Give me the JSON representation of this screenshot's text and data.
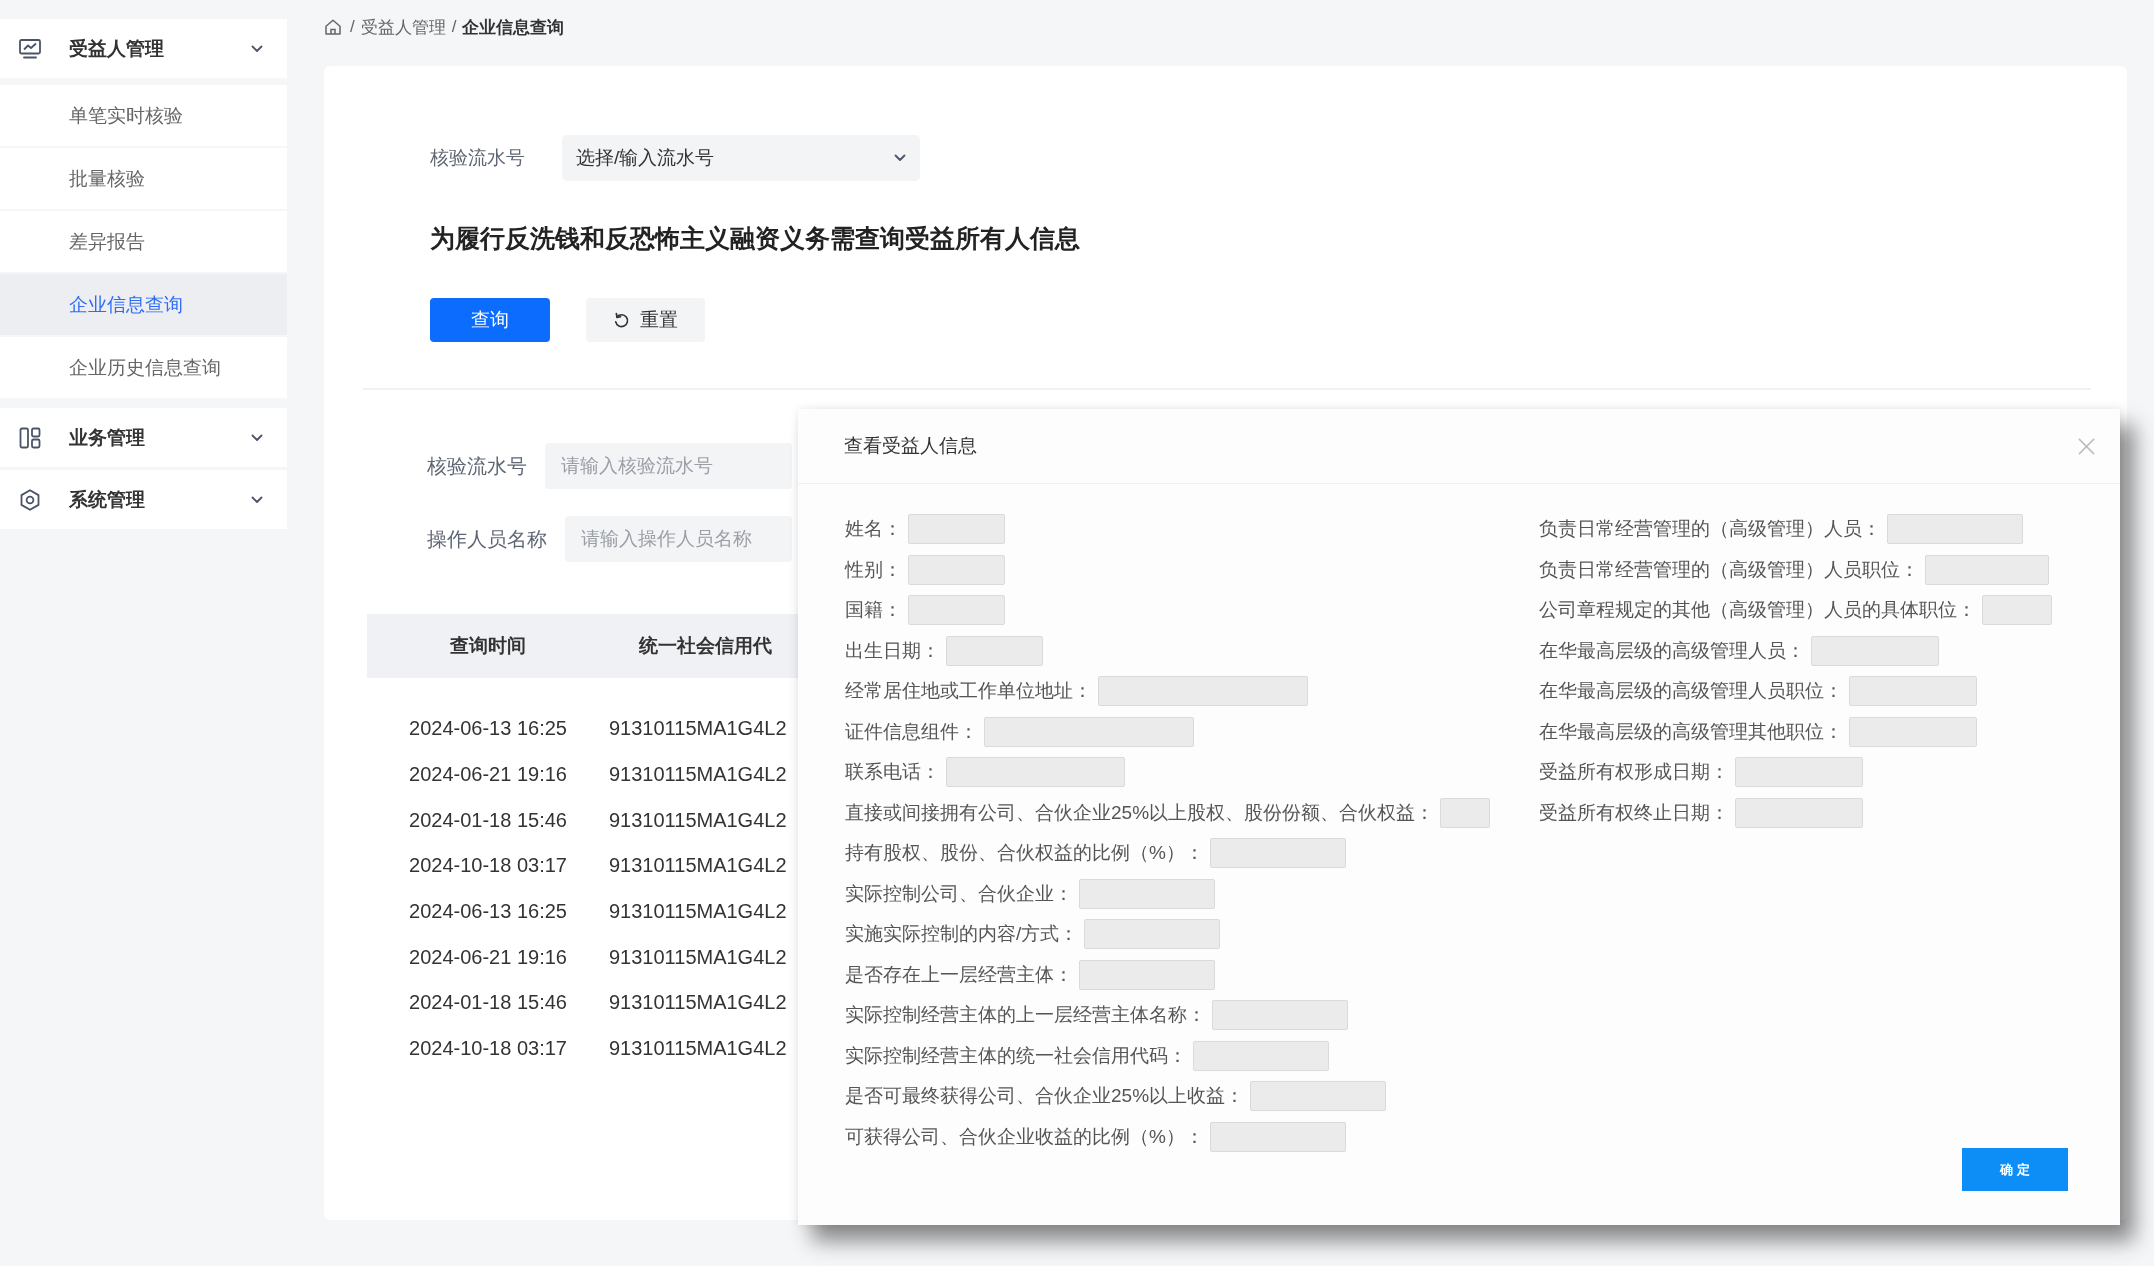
{
  "sidebar": {
    "groups": [
      {
        "label": "受益人管理",
        "children": [
          {
            "label": "单笔实时核验",
            "selected": false
          },
          {
            "label": "批量核验",
            "selected": false
          },
          {
            "label": "差异报告",
            "selected": false
          },
          {
            "label": "企业信息查询",
            "selected": true
          },
          {
            "label": "企业历史信息查询",
            "selected": false
          }
        ]
      },
      {
        "label": "业务管理"
      },
      {
        "label": "系统管理"
      }
    ]
  },
  "breadcrumb": [
    {
      "separator": "/",
      "label": "受益人管理",
      "current": false
    },
    {
      "separator": "/",
      "label": "企业信息查询",
      "current": true
    }
  ],
  "query_form": {
    "label": "核验流水号",
    "select": {
      "value": "选择/输入流水号"
    },
    "notice": "为履行反洗钱和反恐怖主义融资义务需查询受益所有人信息",
    "buttons": [
      {
        "kind": "primary",
        "label": "查询"
      },
      {
        "kind": "reset",
        "label": "重置"
      }
    ]
  },
  "filters": [
    {
      "label": "核验流水号",
      "placeholder": "请输入核验流水号"
    },
    {
      "label": "操作人员名称",
      "placeholder": "请输入操作人员名称"
    }
  ],
  "table": {
    "columns": [
      "查询时间",
      "统一社会信用代"
    ],
    "rows": [
      [
        "2024-06-13 16:25",
        "91310115MA1G4L2"
      ],
      [
        "2024-06-21 19:16",
        "91310115MA1G4L2"
      ],
      [
        "2024-01-18 15:46",
        "91310115MA1G4L2"
      ],
      [
        "2024-10-18 03:17",
        "91310115MA1G4L2"
      ],
      [
        "2024-06-13 16:25",
        "91310115MA1G4L2"
      ],
      [
        "2024-06-21 19:16",
        "91310115MA1G4L2"
      ],
      [
        "2024-01-18 15:46",
        "91310115MA1G4L2"
      ],
      [
        "2024-10-18 03:17",
        "91310115MA1G4L2"
      ]
    ]
  },
  "dialog": {
    "title": "查看受益人信息",
    "left_fields": [
      "姓名：",
      "性别：",
      "国籍：",
      "出生日期：",
      "经常居住地或工作单位地址：",
      "证件信息组件：",
      "联系电话：",
      "直接或间接拥有公司、合伙企业25%以上股权、股份份额、合伙权益：",
      "持有股权、股份、合伙权益的比例（%）：",
      "实际控制公司、合伙企业：",
      "实施实际控制的内容/方式：",
      "是否存在上一层经营主体：",
      "实际控制经营主体的上一层经营主体名称：",
      "实际控制经营主体的统一社会信用代码：",
      "是否可最终获得公司、合伙企业25%以上收益：",
      "可获得公司、合伙企业收益的比例（%）："
    ],
    "right_fields": [
      "负责日常经营管理的（高级管理）人员：",
      "负责日常经营管理的（高级管理）人员职位：",
      "公司章程规定的其他（高级管理）人员的具体职位：",
      "在华最高层级的高级管理人员：",
      "在华最高层级的高级管理人员职位：",
      "在华最高层级的高级管理其他职位：",
      "受益所有权形成日期：",
      "受益所有权终止日期："
    ],
    "confirm_button": "确 定"
  }
}
